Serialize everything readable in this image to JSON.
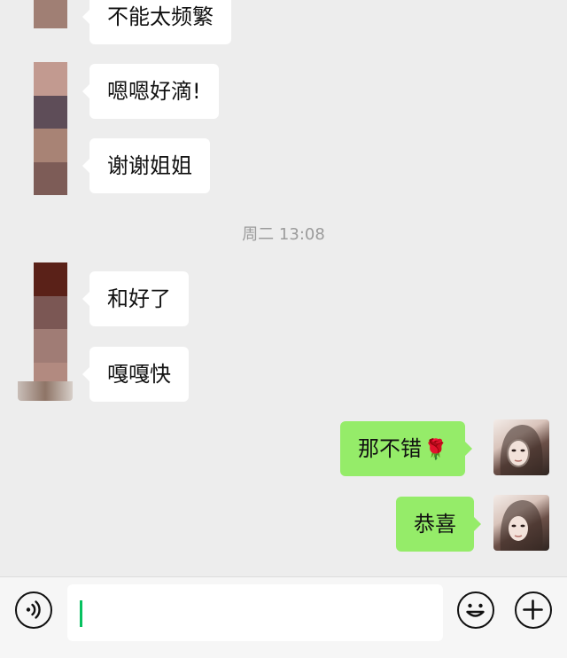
{
  "messages_before": [
    {
      "text": "不能太频繁",
      "sender": "contact"
    },
    {
      "text": "嗯嗯好滴!",
      "sender": "contact"
    },
    {
      "text": "谢谢姐姐",
      "sender": "contact"
    }
  ],
  "timestamp": "周二 13:08",
  "messages_after": [
    {
      "text": "和好了",
      "sender": "contact"
    },
    {
      "text": "嘎嘎快",
      "sender": "contact"
    },
    {
      "text": "那不错",
      "emoji": "🌹",
      "sender": "me"
    },
    {
      "text": "恭喜",
      "sender": "me"
    }
  ],
  "input_bar": {
    "voice_icon": "voice-icon",
    "emoji_icon": "emoji-icon",
    "add_icon": "plus-icon",
    "text_value": ""
  },
  "colors": {
    "background": "#ededed",
    "incoming_bubble": "#ffffff",
    "outgoing_bubble": "#95ec69",
    "caret": "#07c160"
  }
}
